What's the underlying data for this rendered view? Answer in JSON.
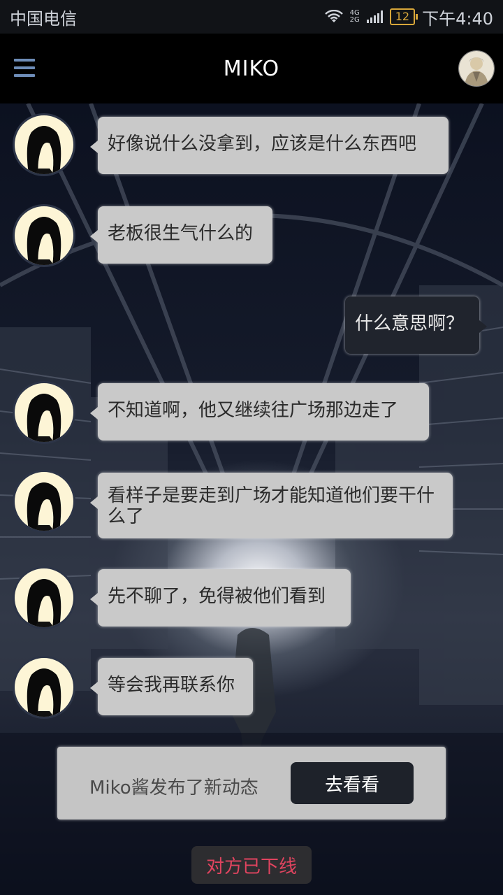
{
  "status_bar": {
    "carrier": "中国电信",
    "network_top": "4G",
    "network_bottom": "2G",
    "battery": "12",
    "time": "下午4:40",
    "icons": [
      "wifi-icon",
      "signal-icon",
      "battery-icon"
    ]
  },
  "header": {
    "title": "MIKO",
    "menu_icon": "hamburger-menu-icon",
    "avatar_icon": "profile-avatar"
  },
  "messages": [
    {
      "side": "in",
      "text": "好像说什么没拿到，应该是什么东西吧"
    },
    {
      "side": "in",
      "text": "老板很生气什么的"
    },
    {
      "side": "out",
      "text": "什么意思啊？"
    },
    {
      "side": "in",
      "text": "不知道啊，他又继续往广场那边走了"
    },
    {
      "side": "in",
      "text": "看样子是要走到广场才能知道他们要干什么了"
    },
    {
      "side": "in",
      "text": "先不聊了，免得被他们看到"
    },
    {
      "side": "in",
      "text": "等会我再联系你"
    }
  ],
  "notice": {
    "text": "Miko酱发布了新动态",
    "button": "去看看"
  },
  "status_message": "对方已下线",
  "colors": {
    "incoming_bubble": "#c9c9c9",
    "outgoing_bubble": "#20242d",
    "offline_text": "#e0445f",
    "menu_icon": "#6e8db8"
  }
}
